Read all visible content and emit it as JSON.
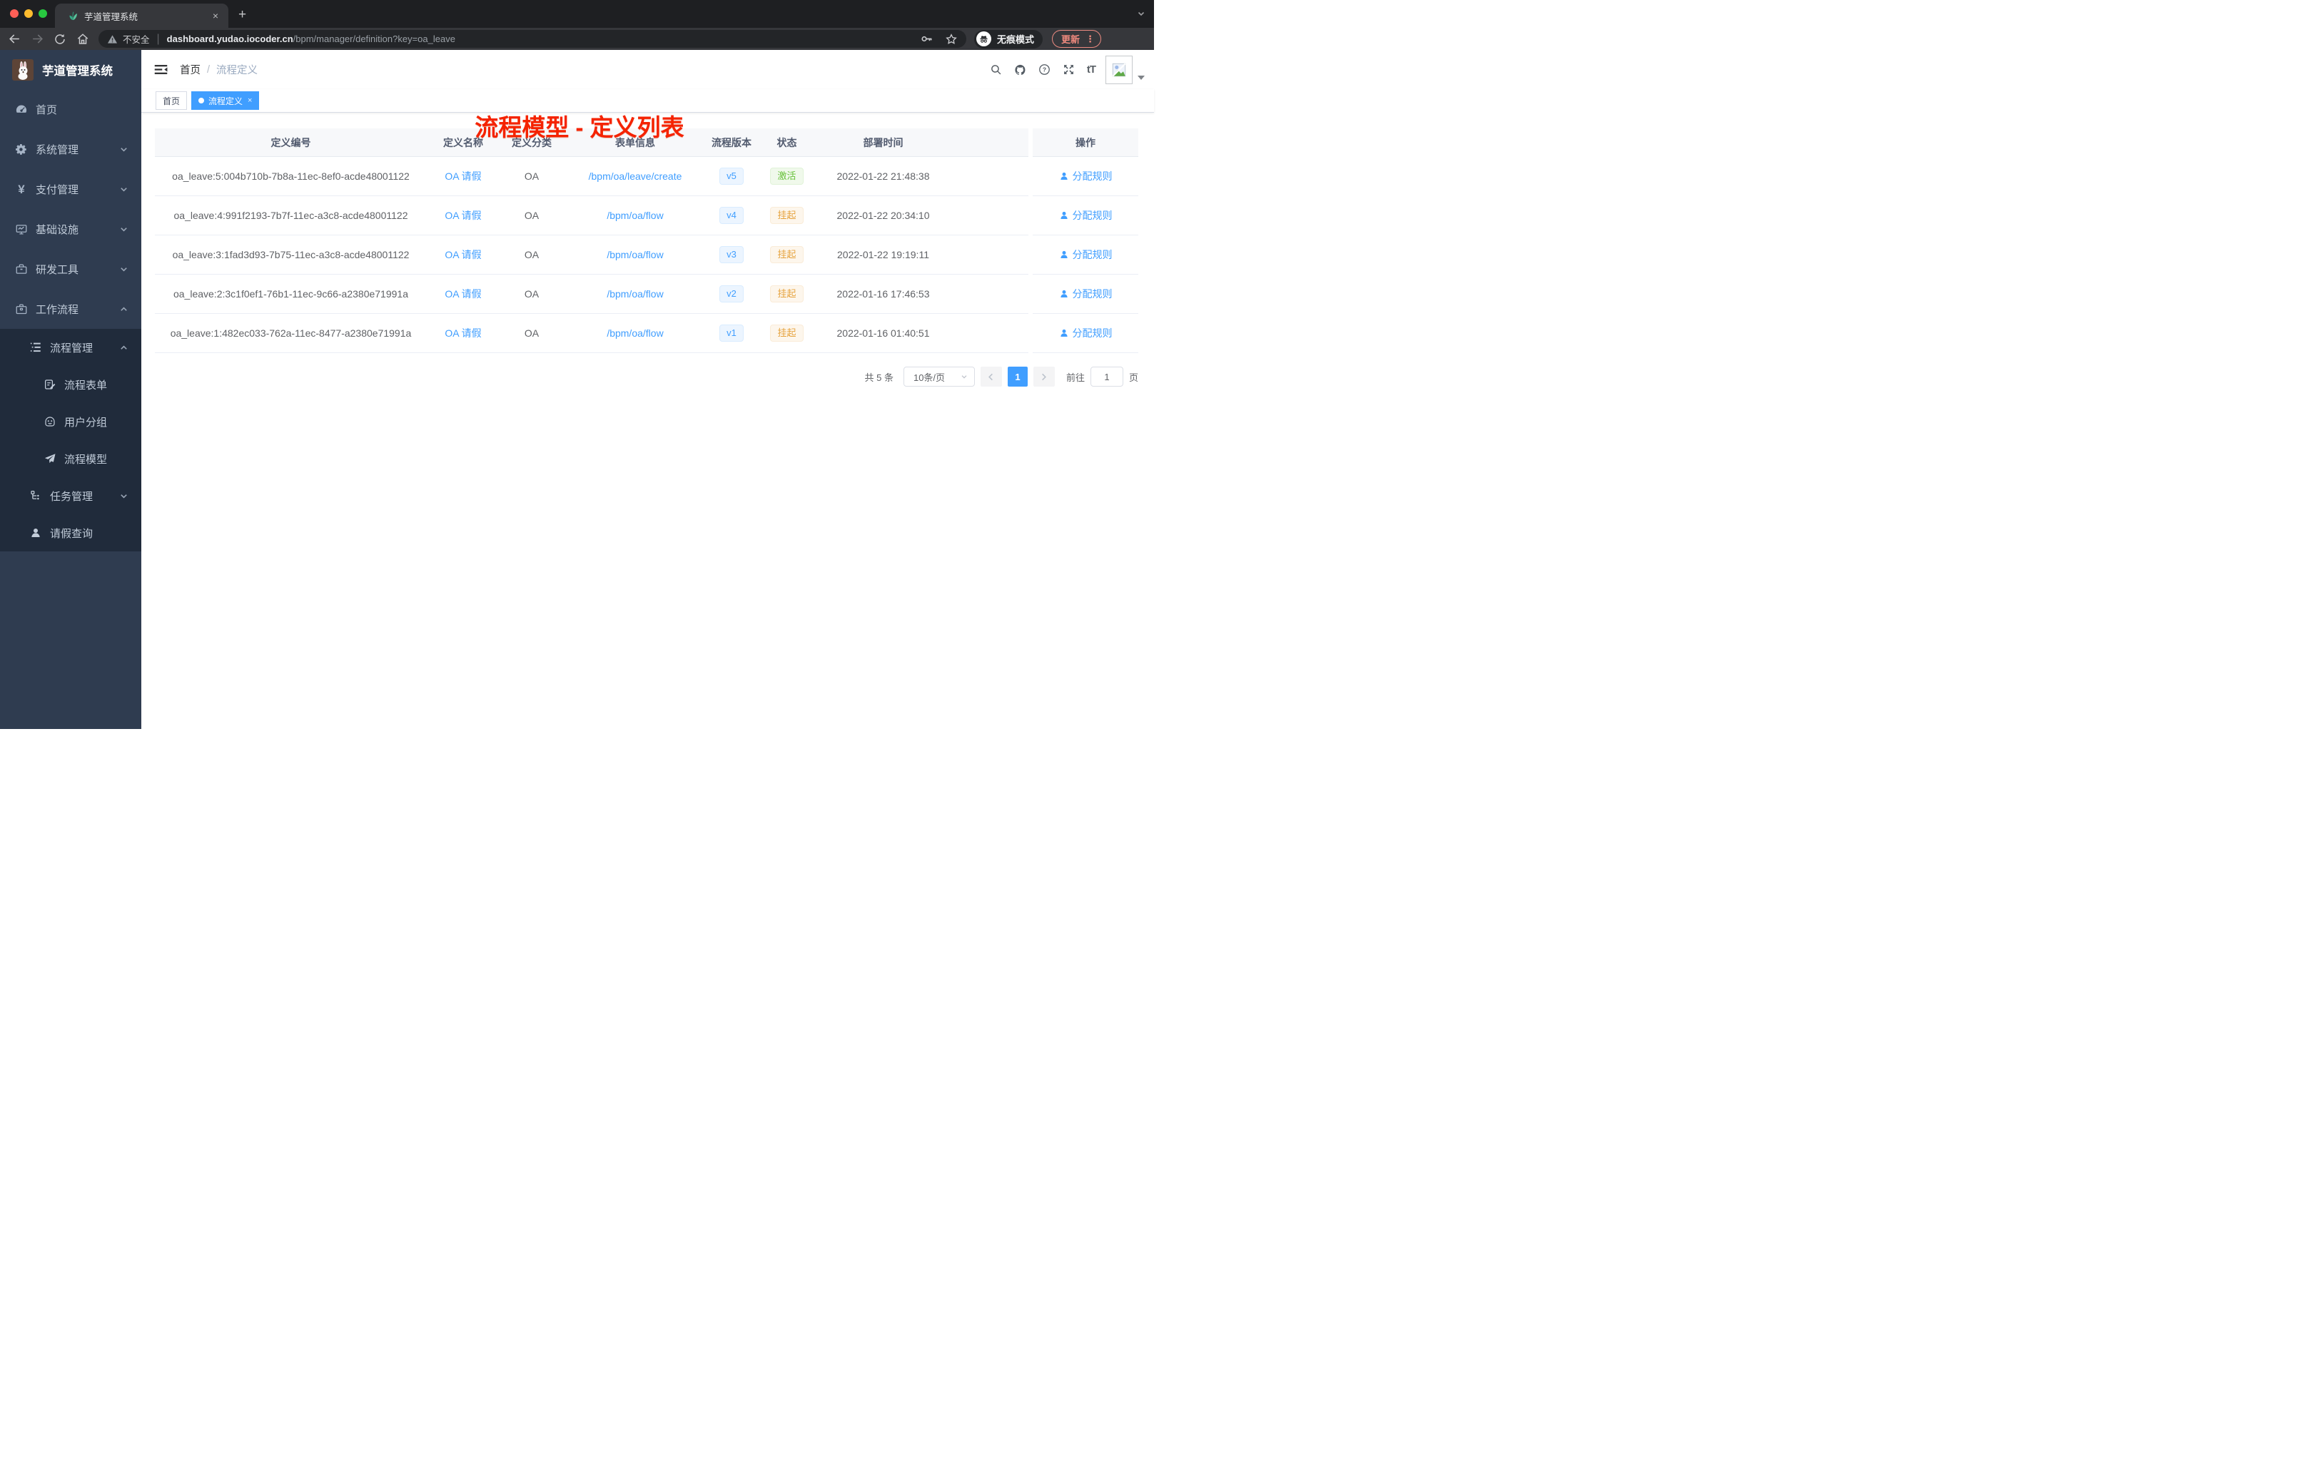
{
  "browser": {
    "tab": {
      "title": "芋道管理系统",
      "close_glyph": "×"
    },
    "new_tab_glyph": "+",
    "security_label": "不安全",
    "url_host": "dashboard.yudao.iocoder.cn",
    "url_path": "/bpm/manager/definition?key=oa_leave",
    "incognito_label": "无痕模式",
    "update_label": "更新",
    "menu_dots_glyph": "⋮"
  },
  "sidebar": {
    "app_title": "芋道管理系统",
    "items": [
      {
        "label": "首页",
        "icon": "dashboard-icon"
      },
      {
        "label": "系统管理",
        "icon": "gear-icon",
        "chevron": "down"
      },
      {
        "label": "支付管理",
        "icon": "yen-icon",
        "chevron": "down"
      },
      {
        "label": "基础设施",
        "icon": "monitor-icon",
        "chevron": "down"
      },
      {
        "label": "研发工具",
        "icon": "toolbox-icon",
        "chevron": "down"
      },
      {
        "label": "工作流程",
        "icon": "briefcase-icon",
        "chevron": "up"
      },
      {
        "label": "流程管理",
        "icon": "tree-list-icon",
        "chevron": "up"
      },
      {
        "label": "流程表单",
        "icon": "form-edit-icon"
      },
      {
        "label": "用户分组",
        "icon": "robot-icon"
      },
      {
        "label": "流程模型",
        "icon": "paper-plane-icon"
      },
      {
        "label": "任务管理",
        "icon": "flow-icon",
        "chevron": "down"
      },
      {
        "label": "请假查询",
        "icon": "user-icon"
      }
    ]
  },
  "header": {
    "breadcrumb": {
      "home": "首页",
      "separator": "/",
      "current": "流程定义"
    },
    "fontsize_glyph": "tT",
    "annotation": "流程模型 - 定义列表"
  },
  "tags": {
    "home": "首页",
    "active": "流程定义",
    "close_glyph": "×"
  },
  "table": {
    "columns": [
      "定义编号",
      "定义名称",
      "定义分类",
      "表单信息",
      "流程版本",
      "状态",
      "部署时间",
      "操作"
    ],
    "rows": [
      {
        "id": "oa_leave:5:004b710b-7b8a-11ec-8ef0-acde48001122",
        "name": "OA 请假",
        "category": "OA",
        "form": "/bpm/oa/leave/create",
        "version": "v5",
        "status": "激活",
        "status_type": "success",
        "time": "2022-01-22 21:48:38",
        "action": "分配规则"
      },
      {
        "id": "oa_leave:4:991f2193-7b7f-11ec-a3c8-acde48001122",
        "name": "OA 请假",
        "category": "OA",
        "form": "/bpm/oa/flow",
        "version": "v4",
        "status": "挂起",
        "status_type": "warning",
        "time": "2022-01-22 20:34:10",
        "action": "分配规则"
      },
      {
        "id": "oa_leave:3:1fad3d93-7b75-11ec-a3c8-acde48001122",
        "name": "OA 请假",
        "category": "OA",
        "form": "/bpm/oa/flow",
        "version": "v3",
        "status": "挂起",
        "status_type": "warning",
        "time": "2022-01-22 19:19:11",
        "action": "分配规则"
      },
      {
        "id": "oa_leave:2:3c1f0ef1-76b1-11ec-9c66-a2380e71991a",
        "name": "OA 请假",
        "category": "OA",
        "form": "/bpm/oa/flow",
        "version": "v2",
        "status": "挂起",
        "status_type": "warning",
        "time": "2022-01-16 17:46:53",
        "action": "分配规则"
      },
      {
        "id": "oa_leave:1:482ec033-762a-11ec-8477-a2380e71991a",
        "name": "OA 请假",
        "category": "OA",
        "form": "/bpm/oa/flow",
        "version": "v1",
        "status": "挂起",
        "status_type": "warning",
        "time": "2022-01-16 01:40:51",
        "action": "分配规则"
      }
    ]
  },
  "pagination": {
    "total": "共 5 条",
    "page_size": "10条/页",
    "current_page": "1",
    "goto_label": "前往",
    "goto_value": "1",
    "page_unit": "页"
  },
  "colors": {
    "accent": "#409eff",
    "success": "#67c23a",
    "warning": "#e6a23c",
    "sidebar": "#2f3c50",
    "annotation": "#f52300"
  }
}
